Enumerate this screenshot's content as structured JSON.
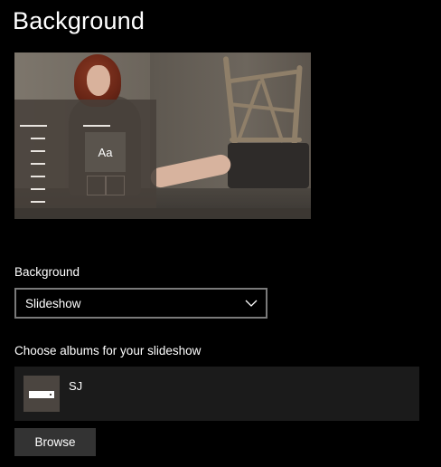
{
  "page": {
    "title": "Background"
  },
  "preview": {
    "sample_text": "Aa"
  },
  "background_setting": {
    "label": "Background",
    "selected": "Slideshow"
  },
  "albums": {
    "label": "Choose albums for your slideshow",
    "items": [
      {
        "name": "SJ"
      }
    ]
  },
  "actions": {
    "browse_label": "Browse"
  },
  "icons": {
    "dropdown": "chevron-down-icon",
    "album": "album-thumbnail"
  },
  "colors": {
    "page_background": "#000000",
    "text": "#ffffff",
    "dropdown_border": "#7a7a7a",
    "album_list_background": "#1b1b1b",
    "button_background": "#333333"
  }
}
